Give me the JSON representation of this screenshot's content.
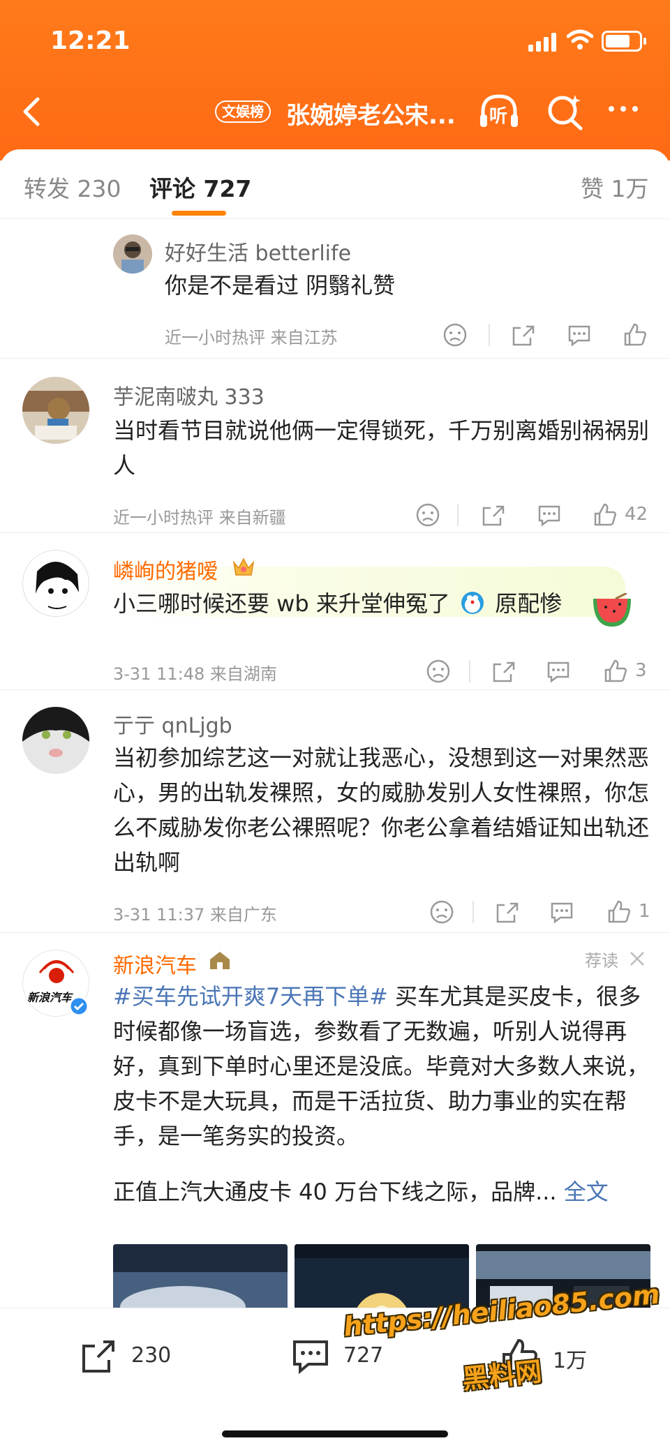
{
  "status": {
    "time": "12:21"
  },
  "nav": {
    "tag": "文娱榜",
    "title": "张婉婷老公宋...",
    "listen_label": "听"
  },
  "tabs": {
    "repost": "转发 230",
    "comment": "评论 727",
    "like": "赞 1万"
  },
  "comments": [
    {
      "user": "好好生活 betterlife",
      "text": "你是不是看过 阴翳礼赞",
      "meta": "近一小时热评  来自江苏",
      "likes": ""
    },
    {
      "user": "芋泥南啵丸 333",
      "text": "当时看节目就说他俩一定得锁死，千万别离婚别祸祸别人",
      "meta": "近一小时热评  来自新疆",
      "likes": "42"
    },
    {
      "user": "嶙峋的猪嗳",
      "text": "小三哪时候还要 wb 来升堂伸冤了",
      "text_tail": "原配惨",
      "meta": "3-31 11:48  来自湖南",
      "likes": "3"
    },
    {
      "user": "亍亍 qnLjgb",
      "text": "当初参加综艺这一对就让我恶心，没想到这一对果然恶心，男的出轨发裸照，女的威胁发别人女性裸照，你怎么不威胁发你老公裸照呢？你老公拿着结婚证知出轨还出轨啊",
      "meta": "3-31 11:37  来自广东",
      "likes": "1"
    }
  ],
  "ad": {
    "user": "新浪汽车",
    "logo_text": "新浪汽车",
    "rec_label": "荐读",
    "hashtag": "#买车先试开爽7天再下单#",
    "text1": " 买车尤其是买皮卡，很多时候都像一场盲选，参数看了无数遍，听别人说得再好，真到下单时心里还是没底。毕竟对大多数人来说，皮卡不是大玩具，而是干活拉货、助力事业的实在帮手，是一笔务实的投资。",
    "text2": "正值上汽大通皮卡 40 万台下线之际，品牌...",
    "full_label": "全文"
  },
  "bottom": {
    "repost": "230",
    "comment": "727",
    "like": "1万"
  },
  "watermark": {
    "line1": "https://heiliao85.com",
    "line2": "黑料网"
  },
  "colors": {
    "header": "#ff7a1a",
    "accent": "#ff8200",
    "link": "#4a76b5"
  }
}
